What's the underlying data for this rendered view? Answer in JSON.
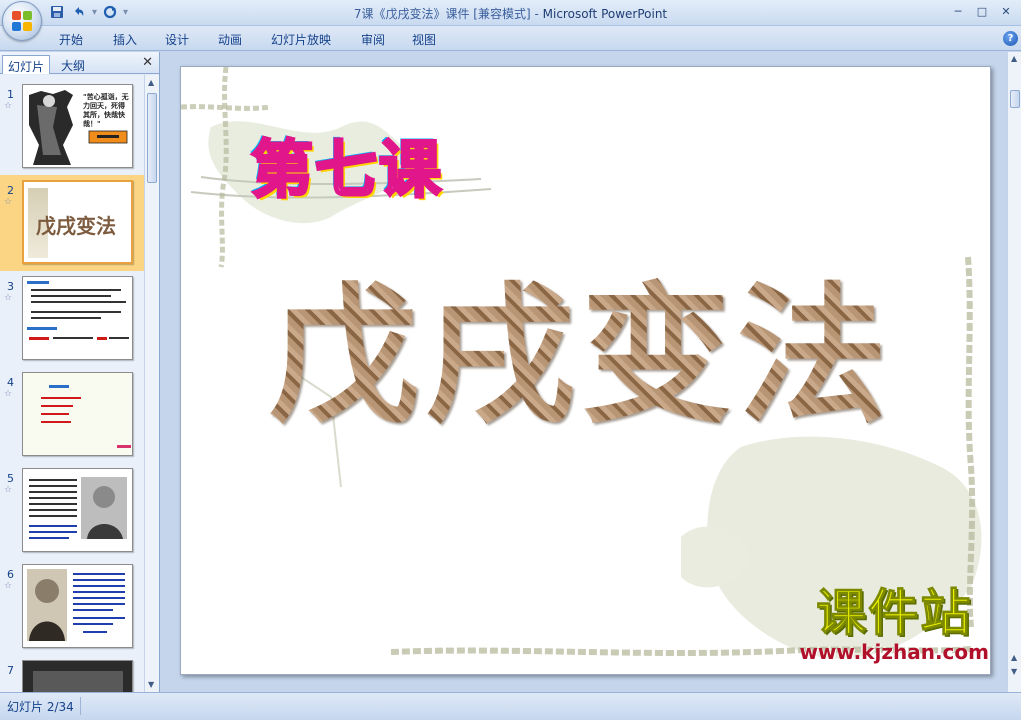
{
  "window": {
    "title_prefix": "7课《戊戌变法》课件 [兼容模式] - ",
    "app_name": "Microsoft PowerPoint",
    "controls": [
      "─",
      "□",
      "✕"
    ]
  },
  "quick_access": {
    "save_icon": "save-icon",
    "undo_icon": "undo-icon",
    "redo_icon": "redo-icon"
  },
  "ribbon": {
    "tabs": [
      "开始",
      "插入",
      "设计",
      "动画",
      "幻灯片放映",
      "审阅",
      "视图"
    ],
    "help": "?"
  },
  "left_pane": {
    "tabs": [
      "幻灯片",
      "大纲"
    ],
    "close": "✕",
    "slides": [
      {
        "num": "1",
        "text": "\"苦心孤诣，无力回天，死得其所，快哉快哉！\""
      },
      {
        "num": "2",
        "text": "戊戌变法",
        "selected": true
      },
      {
        "num": "3",
        "text": ""
      },
      {
        "num": "4",
        "text": ""
      },
      {
        "num": "5",
        "text": ""
      },
      {
        "num": "6",
        "text": ""
      },
      {
        "num": "7",
        "text": ""
      }
    ]
  },
  "slide": {
    "kicker": "第七课",
    "title": "戊戌变法"
  },
  "watermark": {
    "main": "课件站",
    "url": "www.kjzhan.com"
  },
  "status": {
    "slide_counter": "幻灯片 2/34"
  },
  "colors": {
    "ribbon_bg": "#c8d9ef",
    "selected_thumb": "#fbd583",
    "title_text": "#15428b"
  }
}
